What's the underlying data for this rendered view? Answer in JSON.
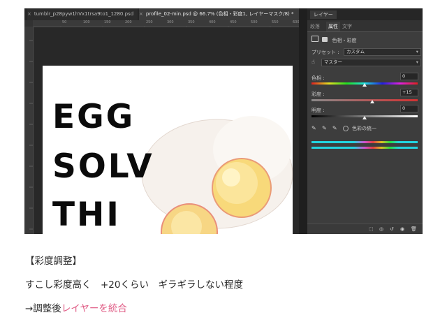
{
  "tabs": [
    {
      "label": "tumblr_p28pyw1hVx1trsa9to1_1280.psd"
    },
    {
      "label": "profile_02-min.psd @ 66.7% (色相・彩度1, レイヤーマスク/8) *"
    }
  ],
  "tab_close_glyph": "×",
  "ruler_marks": [
    "50",
    "100",
    "150",
    "200",
    "250",
    "300",
    "350",
    "400",
    "450",
    "500",
    "550",
    "600"
  ],
  "document": {
    "lines": [
      "EGG",
      "SOLV",
      "THI"
    ]
  },
  "layers_panel": {
    "title": "レイヤー"
  },
  "properties_panel": {
    "tabs": [
      {
        "label": "段落",
        "active": false
      },
      {
        "label": "属性",
        "active": true
      },
      {
        "label": "文字",
        "active": false
      }
    ],
    "adjustment_title": "色相・彩度",
    "preset_label": "プリセット :",
    "preset_value": "カスタム",
    "channel_value": "マスター",
    "hue_label": "色相 :",
    "hue_value": "0",
    "hue_level": 0.5,
    "saturation_label": "彩度 :",
    "saturation_value": "+15",
    "saturation_level": 0.575,
    "lightness_label": "明度 :",
    "lightness_value": "0",
    "lightness_level": 0.5,
    "colorize_label": "色彩の統一"
  },
  "caption": {
    "heading": "【彩度調整】",
    "line2": "すこし彩度高く　+20くらい　ギラギラしない程度",
    "line3_prefix": "→調整後",
    "line3_accent": "レイヤーを統合"
  },
  "colors": {
    "accent": "#e05d86",
    "panel_bg": "#3d3d3d",
    "canvas_bg": "#282828"
  }
}
